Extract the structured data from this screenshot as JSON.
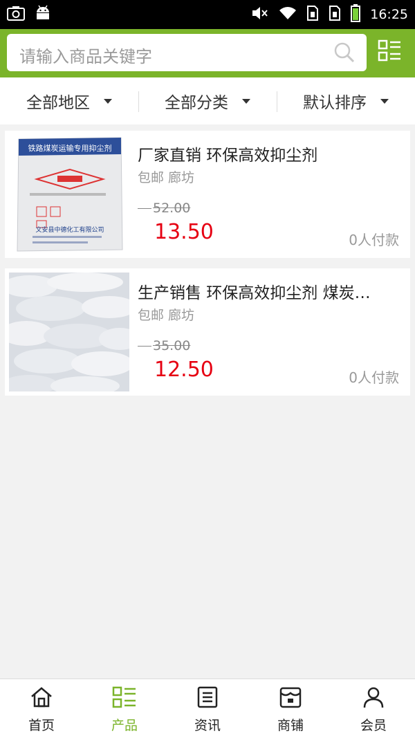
{
  "status_bar": {
    "time": "16:25",
    "icons": [
      "camera-icon",
      "android-icon",
      "mute-icon",
      "wifi-icon",
      "sim1-icon",
      "sim2-icon",
      "battery-icon"
    ]
  },
  "search": {
    "placeholder": "请输入商品关键字",
    "icon": "search-icon",
    "menu_icon": "grid-list-icon"
  },
  "colors": {
    "brand": "#7bb42a",
    "price": "#e60012"
  },
  "filters": [
    {
      "label": "全部地区"
    },
    {
      "label": "全部分类"
    },
    {
      "label": "默认排序"
    }
  ],
  "products": [
    {
      "title": "厂家直销 环保高效抑尘剂",
      "tags": "包邮 廊坊",
      "old_price": "52.00",
      "price": "13.50",
      "sales": "0人付款",
      "image_text": {
        "bag_label": "铁路煤炭运输专用抑尘剂",
        "company": "文安县中德化工有限公司"
      }
    },
    {
      "title": "生产销售 环保高效抑尘剂 煤炭…",
      "tags": "包邮 廊坊",
      "old_price": "35.00",
      "price": "12.50",
      "sales": "0人付款"
    }
  ],
  "nav": [
    {
      "label": "首页",
      "icon": "home-icon",
      "active": false
    },
    {
      "label": "产品",
      "icon": "product-list-icon",
      "active": true
    },
    {
      "label": "资讯",
      "icon": "news-icon",
      "active": false
    },
    {
      "label": "商铺",
      "icon": "shop-icon",
      "active": false
    },
    {
      "label": "会员",
      "icon": "member-icon",
      "active": false
    }
  ]
}
